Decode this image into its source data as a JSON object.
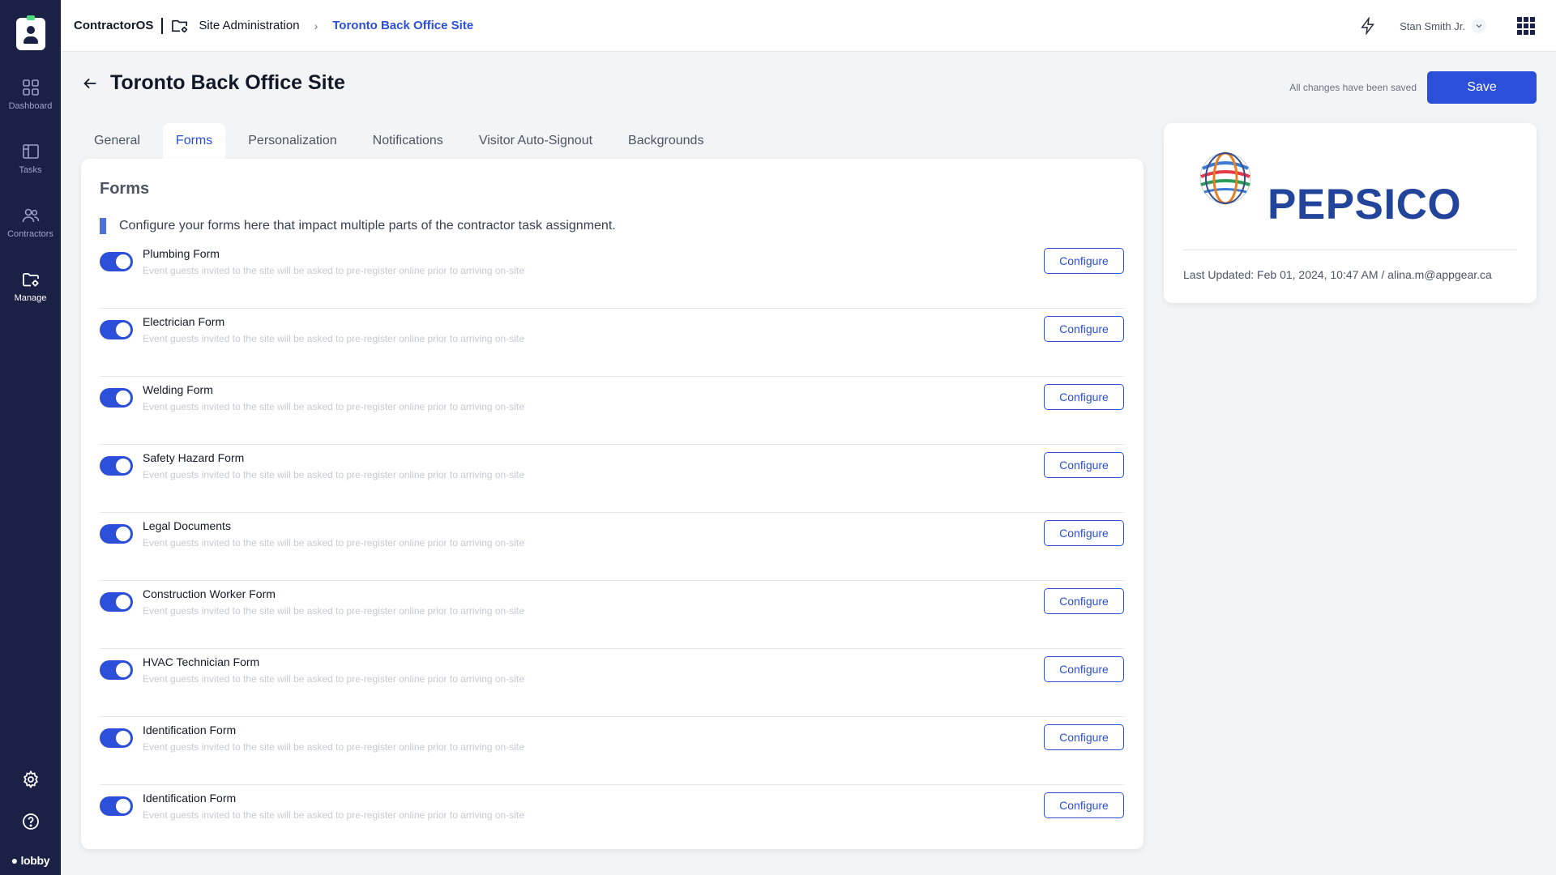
{
  "sidebar": {
    "items": [
      {
        "label": "Dashboard",
        "icon": "dashboard-icon"
      },
      {
        "label": "Tasks",
        "icon": "tasks-icon"
      },
      {
        "label": "Contractors",
        "icon": "contractors-icon"
      },
      {
        "label": "Manage",
        "icon": "manage-folder-icon"
      }
    ],
    "bottom": {
      "settings_icon": "gear-icon",
      "help_icon": "help-icon",
      "brand": "lobby"
    }
  },
  "topbar": {
    "app_name": "ContractorOS",
    "crumb": "Site Administration",
    "current": "Toronto Back Office Site",
    "user": "Stan Smith Jr.",
    "icons": [
      "bolt-icon",
      "chevron-down-icon",
      "apps-grid-icon"
    ]
  },
  "page": {
    "title": "Toronto Back Office Site",
    "save_status": "All changes have been saved",
    "save_label": "Save"
  },
  "tabs": [
    "General",
    "Forms",
    "Personalization",
    "Notifications",
    "Visitor Auto-Signout",
    "Backgrounds"
  ],
  "active_tab": "Forms",
  "forms": {
    "title": "Forms",
    "description": "Configure your forms here that impact multiple parts of the contractor task assignment.",
    "configure_label": "Configure",
    "items": [
      {
        "name": "Plumbing Form",
        "subtitle": "Event guests invited to the site will be asked to pre-register online prior to arriving on-site",
        "enabled": true
      },
      {
        "name": "Electrician Form",
        "subtitle": "Event guests invited to the site will be asked to pre-register online prior to arriving on-site",
        "enabled": true
      },
      {
        "name": "Welding Form",
        "subtitle": "Event guests invited to the site will be asked to pre-register online prior to arriving on-site",
        "enabled": true
      },
      {
        "name": "Safety Hazard Form",
        "subtitle": "Event guests invited to the site will be asked to pre-register online prior to arriving on-site",
        "enabled": true
      },
      {
        "name": "Legal Documents",
        "subtitle": "Event guests invited to the site will be asked to pre-register online prior to arriving on-site",
        "enabled": true
      },
      {
        "name": "Construction Worker Form",
        "subtitle": "Event guests invited to the site will be asked to pre-register online prior to arriving on-site",
        "enabled": true
      },
      {
        "name": "HVAC Technician Form",
        "subtitle": "Event guests invited to the site will be asked to pre-register online prior to arriving on-site",
        "enabled": true
      },
      {
        "name": "Identification Form",
        "subtitle": "Event guests invited to the site will be asked to pre-register online prior to arriving on-site",
        "enabled": true
      },
      {
        "name": "Identification Form",
        "subtitle": "Event guests invited to the site will be asked to pre-register online prior to arriving on-site",
        "enabled": true
      }
    ]
  },
  "logo_card": {
    "brand": "PEPSICO",
    "last_updated": "Last Updated: Feb 01, 2024, 10:47 AM / alina.m@appgear.ca"
  },
  "colors": {
    "sidebar_bg": "#1b2145",
    "accent": "#2b4fd8",
    "pepsico_blue": "#22459b"
  }
}
